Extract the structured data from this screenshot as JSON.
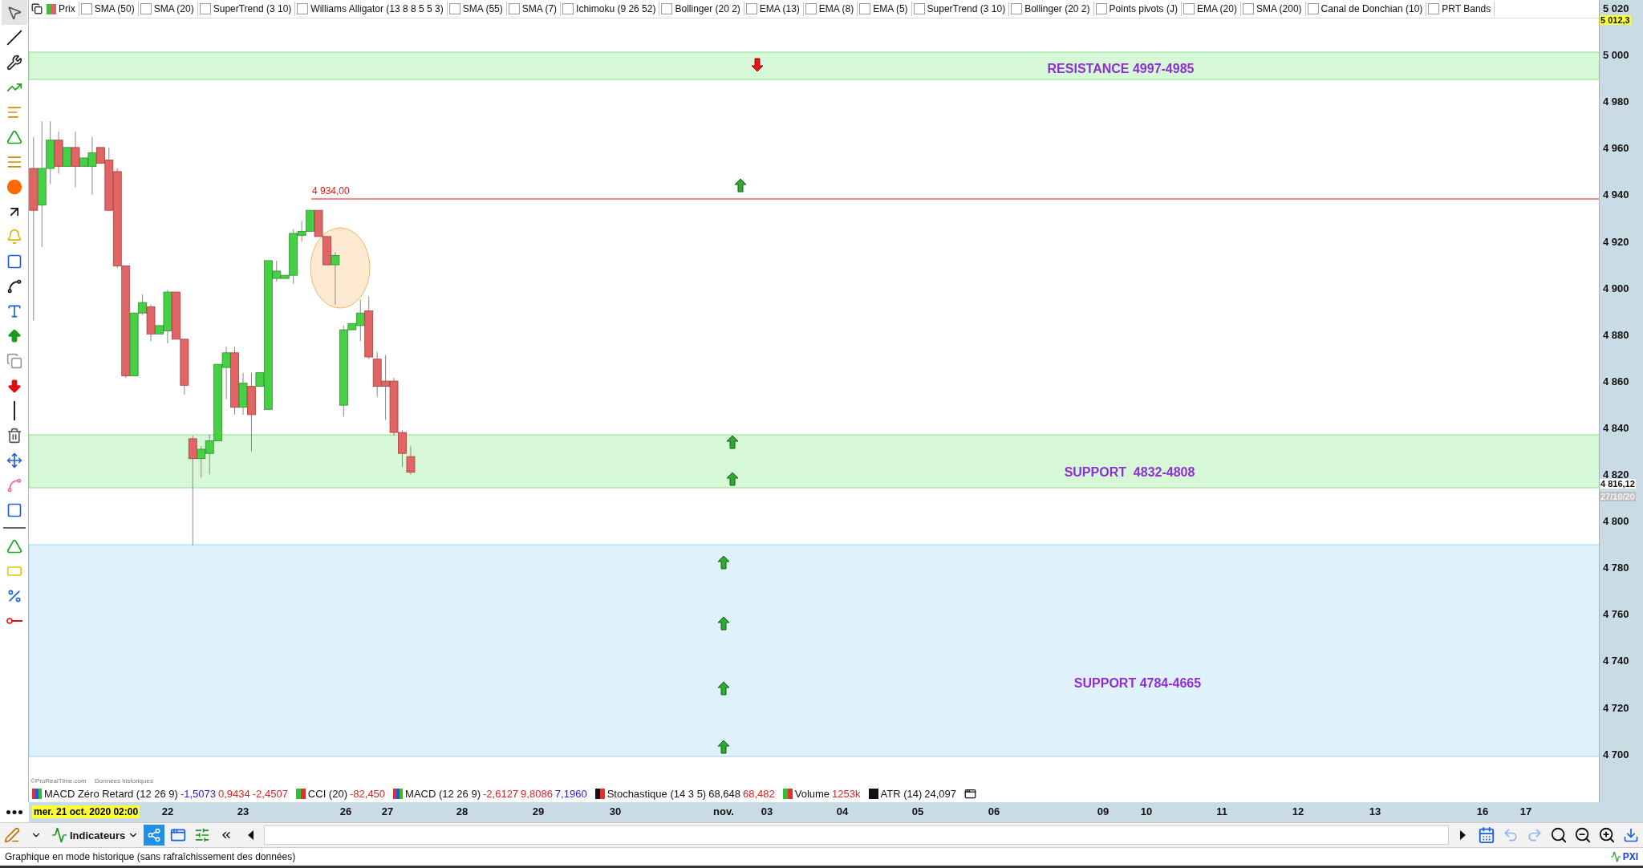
{
  "legend_bar": {
    "price_label": "Prix",
    "indicators": [
      {
        "label": "SMA (50)",
        "checked": false
      },
      {
        "label": "SMA (20)",
        "checked": false
      },
      {
        "label": "SuperTrend (3 10)",
        "checked": false
      },
      {
        "label": "Williams Alligator (13 8 8 5 5 3)",
        "checked": false
      },
      {
        "label": "SMA (55)",
        "checked": false
      },
      {
        "label": "SMA (7)",
        "checked": false
      },
      {
        "label": "Ichimoku (9 26 52)",
        "checked": false
      },
      {
        "label": "Bollinger (20 2)",
        "checked": false
      },
      {
        "label": "EMA (13)",
        "checked": false
      },
      {
        "label": "EMA (8)",
        "checked": false
      },
      {
        "label": "EMA (5)",
        "checked": false
      },
      {
        "label": "SuperTrend (3 10)",
        "checked": false
      },
      {
        "label": "Bollinger (20 2)",
        "checked": false
      },
      {
        "label": "Points pivots (J)",
        "checked": false
      },
      {
        "label": "EMA (20)",
        "checked": false
      },
      {
        "label": "SMA (200)",
        "checked": false
      },
      {
        "label": "Canal de Donchian (10)",
        "checked": false
      },
      {
        "label": "PRT Bands",
        "checked": false
      }
    ]
  },
  "price_chart": {
    "line_label": "4 934,00",
    "zones": [
      {
        "label": "RESISTANCE 4997-4985",
        "kind": "resistance"
      },
      {
        "label": "SUPPORT  4832-4808",
        "kind": "support"
      },
      {
        "label": "SUPPORT 4784-4665",
        "kind": "support_wide"
      }
    ],
    "source_note": [
      "©ProRealTime.com",
      "Données historiques"
    ]
  },
  "price_axis": {
    "ticks": [
      "5 020",
      "5 000",
      "4 980",
      "4 960",
      "4 940",
      "4 920",
      "4 900",
      "4 880",
      "4 860",
      "4 840",
      "4 820",
      "4 800",
      "4 780",
      "4 760",
      "4 740",
      "4 720",
      "4 700"
    ],
    "last_price": "5 012,3",
    "current_price": "4 816,12",
    "current_date": "27/10/20"
  },
  "indicator_legend": [
    {
      "name": "MACD Zéro Retard (12 26 9)",
      "kind": "multi",
      "values": [
        {
          "text": "-1,5073",
          "color": "#1f1fd0"
        },
        {
          "text": "0,9434",
          "color": "#e02020"
        },
        {
          "text": "-2,4507",
          "color": "#e02020"
        }
      ]
    },
    {
      "name": "CCI (20)",
      "kind": "green_red",
      "values": [
        {
          "text": "-82,450",
          "color": "#e02020"
        }
      ]
    },
    {
      "name": "MACD (12 26 9)",
      "kind": "multi",
      "values": [
        {
          "text": "-2,6127",
          "color": "#e02020"
        },
        {
          "text": "9,8086",
          "color": "#e02020"
        },
        {
          "text": "7,1960",
          "color": "#1f1fd0"
        }
      ]
    },
    {
      "name": "Stochastique (14 3 5)",
      "kind": "black_red",
      "values": [
        {
          "text": "68,648",
          "color": "#111111"
        },
        {
          "text": "68,482",
          "color": "#e02020"
        }
      ]
    },
    {
      "name": "Volume",
      "kind": "green_red",
      "values": [
        {
          "text": "1253k",
          "color": "#e02020"
        }
      ]
    },
    {
      "name": "ATR (14)",
      "kind": "black",
      "values": [
        {
          "text": "24,097",
          "color": "#111111"
        }
      ]
    }
  ],
  "date_axis": {
    "cursor_date": "mer. 21 oct. 2020 02:00",
    "labels": [
      "22",
      "23",
      "26",
      "27",
      "28",
      "29",
      "30",
      "nov.",
      "03",
      "04",
      "05",
      "06",
      "09",
      "10",
      "11",
      "12",
      "13",
      "16",
      "17"
    ]
  },
  "bottom_toolbar": {
    "indicators_button": "Indicateurs"
  },
  "status_bar": {
    "message": "Graphique en mode historique (sans rafraîchissement des données)",
    "badge": "PXI"
  }
}
